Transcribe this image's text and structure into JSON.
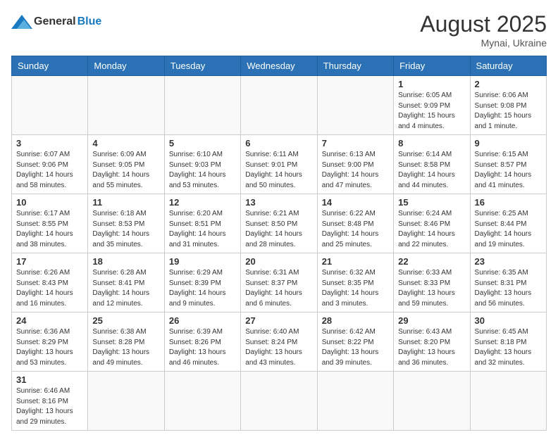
{
  "header": {
    "logo_general": "General",
    "logo_blue": "Blue",
    "month_year": "August 2025",
    "location": "Mynai, Ukraine"
  },
  "weekdays": [
    "Sunday",
    "Monday",
    "Tuesday",
    "Wednesday",
    "Thursday",
    "Friday",
    "Saturday"
  ],
  "weeks": [
    [
      {
        "day": "",
        "info": ""
      },
      {
        "day": "",
        "info": ""
      },
      {
        "day": "",
        "info": ""
      },
      {
        "day": "",
        "info": ""
      },
      {
        "day": "",
        "info": ""
      },
      {
        "day": "1",
        "info": "Sunrise: 6:05 AM\nSunset: 9:09 PM\nDaylight: 15 hours and 4 minutes."
      },
      {
        "day": "2",
        "info": "Sunrise: 6:06 AM\nSunset: 9:08 PM\nDaylight: 15 hours and 1 minute."
      }
    ],
    [
      {
        "day": "3",
        "info": "Sunrise: 6:07 AM\nSunset: 9:06 PM\nDaylight: 14 hours and 58 minutes."
      },
      {
        "day": "4",
        "info": "Sunrise: 6:09 AM\nSunset: 9:05 PM\nDaylight: 14 hours and 55 minutes."
      },
      {
        "day": "5",
        "info": "Sunrise: 6:10 AM\nSunset: 9:03 PM\nDaylight: 14 hours and 53 minutes."
      },
      {
        "day": "6",
        "info": "Sunrise: 6:11 AM\nSunset: 9:01 PM\nDaylight: 14 hours and 50 minutes."
      },
      {
        "day": "7",
        "info": "Sunrise: 6:13 AM\nSunset: 9:00 PM\nDaylight: 14 hours and 47 minutes."
      },
      {
        "day": "8",
        "info": "Sunrise: 6:14 AM\nSunset: 8:58 PM\nDaylight: 14 hours and 44 minutes."
      },
      {
        "day": "9",
        "info": "Sunrise: 6:15 AM\nSunset: 8:57 PM\nDaylight: 14 hours and 41 minutes."
      }
    ],
    [
      {
        "day": "10",
        "info": "Sunrise: 6:17 AM\nSunset: 8:55 PM\nDaylight: 14 hours and 38 minutes."
      },
      {
        "day": "11",
        "info": "Sunrise: 6:18 AM\nSunset: 8:53 PM\nDaylight: 14 hours and 35 minutes."
      },
      {
        "day": "12",
        "info": "Sunrise: 6:20 AM\nSunset: 8:51 PM\nDaylight: 14 hours and 31 minutes."
      },
      {
        "day": "13",
        "info": "Sunrise: 6:21 AM\nSunset: 8:50 PM\nDaylight: 14 hours and 28 minutes."
      },
      {
        "day": "14",
        "info": "Sunrise: 6:22 AM\nSunset: 8:48 PM\nDaylight: 14 hours and 25 minutes."
      },
      {
        "day": "15",
        "info": "Sunrise: 6:24 AM\nSunset: 8:46 PM\nDaylight: 14 hours and 22 minutes."
      },
      {
        "day": "16",
        "info": "Sunrise: 6:25 AM\nSunset: 8:44 PM\nDaylight: 14 hours and 19 minutes."
      }
    ],
    [
      {
        "day": "17",
        "info": "Sunrise: 6:26 AM\nSunset: 8:43 PM\nDaylight: 14 hours and 16 minutes."
      },
      {
        "day": "18",
        "info": "Sunrise: 6:28 AM\nSunset: 8:41 PM\nDaylight: 14 hours and 12 minutes."
      },
      {
        "day": "19",
        "info": "Sunrise: 6:29 AM\nSunset: 8:39 PM\nDaylight: 14 hours and 9 minutes."
      },
      {
        "day": "20",
        "info": "Sunrise: 6:31 AM\nSunset: 8:37 PM\nDaylight: 14 hours and 6 minutes."
      },
      {
        "day": "21",
        "info": "Sunrise: 6:32 AM\nSunset: 8:35 PM\nDaylight: 14 hours and 3 minutes."
      },
      {
        "day": "22",
        "info": "Sunrise: 6:33 AM\nSunset: 8:33 PM\nDaylight: 13 hours and 59 minutes."
      },
      {
        "day": "23",
        "info": "Sunrise: 6:35 AM\nSunset: 8:31 PM\nDaylight: 13 hours and 56 minutes."
      }
    ],
    [
      {
        "day": "24",
        "info": "Sunrise: 6:36 AM\nSunset: 8:29 PM\nDaylight: 13 hours and 53 minutes."
      },
      {
        "day": "25",
        "info": "Sunrise: 6:38 AM\nSunset: 8:28 PM\nDaylight: 13 hours and 49 minutes."
      },
      {
        "day": "26",
        "info": "Sunrise: 6:39 AM\nSunset: 8:26 PM\nDaylight: 13 hours and 46 minutes."
      },
      {
        "day": "27",
        "info": "Sunrise: 6:40 AM\nSunset: 8:24 PM\nDaylight: 13 hours and 43 minutes."
      },
      {
        "day": "28",
        "info": "Sunrise: 6:42 AM\nSunset: 8:22 PM\nDaylight: 13 hours and 39 minutes."
      },
      {
        "day": "29",
        "info": "Sunrise: 6:43 AM\nSunset: 8:20 PM\nDaylight: 13 hours and 36 minutes."
      },
      {
        "day": "30",
        "info": "Sunrise: 6:45 AM\nSunset: 8:18 PM\nDaylight: 13 hours and 32 minutes."
      }
    ],
    [
      {
        "day": "31",
        "info": "Sunrise: 6:46 AM\nSunset: 8:16 PM\nDaylight: 13 hours and 29 minutes."
      },
      {
        "day": "",
        "info": ""
      },
      {
        "day": "",
        "info": ""
      },
      {
        "day": "",
        "info": ""
      },
      {
        "day": "",
        "info": ""
      },
      {
        "day": "",
        "info": ""
      },
      {
        "day": "",
        "info": ""
      }
    ]
  ]
}
